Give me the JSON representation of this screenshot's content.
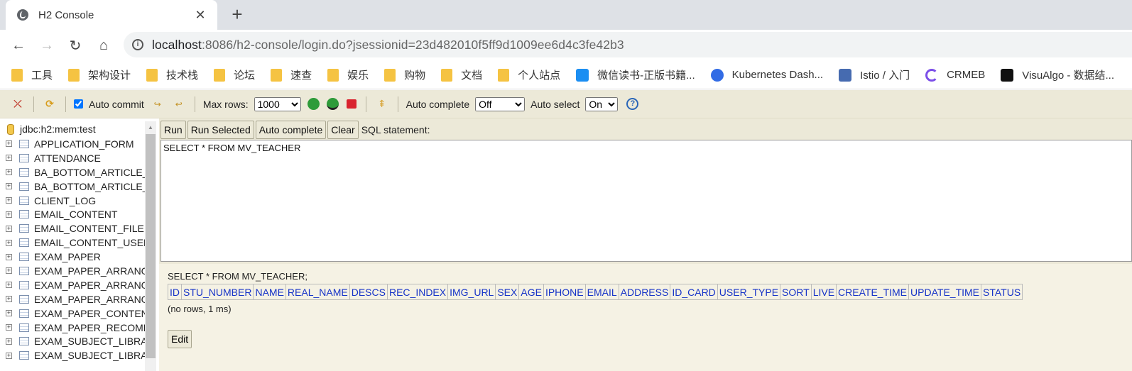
{
  "tab": {
    "title": "H2 Console",
    "close": "✕",
    "new_tab": "+"
  },
  "nav": {
    "back": "←",
    "forward": "→",
    "reload": "↻",
    "home": "⌂"
  },
  "url": {
    "host": "localhost",
    "rest": ":8086/h2-console/login.do?jsessionid=23d482010f5ff9d1009ee6d4c3fe42b3"
  },
  "bookmarks": [
    {
      "label": "工具",
      "icon": "folder-icon"
    },
    {
      "label": "架构设计",
      "icon": "folder-icon"
    },
    {
      "label": "技术栈",
      "icon": "folder-icon"
    },
    {
      "label": "论坛",
      "icon": "folder-icon"
    },
    {
      "label": "速查",
      "icon": "folder-icon"
    },
    {
      "label": "娱乐",
      "icon": "folder-icon"
    },
    {
      "label": "购物",
      "icon": "folder-icon"
    },
    {
      "label": "文档",
      "icon": "folder-icon"
    },
    {
      "label": "个人站点",
      "icon": "folder-icon"
    },
    {
      "label": "微信读书-正版书籍...",
      "icon": "weread-icon"
    },
    {
      "label": "Kubernetes Dash...",
      "icon": "kubernetes-icon"
    },
    {
      "label": "Istio / 入门",
      "icon": "istio-icon"
    },
    {
      "label": "CRMEB",
      "icon": "crmeb-icon"
    },
    {
      "label": "VisuAlgo - 数据结...",
      "icon": "visualgo-icon"
    }
  ],
  "toolbar": {
    "auto_commit": "Auto commit",
    "max_rows_label": "Max rows:",
    "max_rows_value": "1000",
    "auto_complete_label": "Auto complete",
    "auto_complete_value": "Off",
    "auto_select_label": "Auto select",
    "auto_select_value": "On",
    "help": "?"
  },
  "tree": {
    "root": "jdbc:h2:mem:test",
    "tables": [
      "APPLICATION_FORM",
      "ATTENDANCE",
      "BA_BOTTOM_ARTICLE_",
      "BA_BOTTOM_ARTICLE_",
      "CLIENT_LOG",
      "EMAIL_CONTENT",
      "EMAIL_CONTENT_FILE",
      "EMAIL_CONTENT_USER",
      "EXAM_PAPER",
      "EXAM_PAPER_ARRANG",
      "EXAM_PAPER_ARRANG",
      "EXAM_PAPER_ARRANG",
      "EXAM_PAPER_CONTEN",
      "EXAM_PAPER_RECOMM",
      "EXAM_SUBJECT_LIBRA",
      "EXAM_SUBJECT_LIBRA"
    ]
  },
  "query": {
    "run": "Run",
    "run_selected": "Run Selected",
    "auto_complete": "Auto complete",
    "clear": "Clear",
    "sql_label": "SQL statement:",
    "sql": "SELECT * FROM MV_TEACHER"
  },
  "result": {
    "statement": "SELECT * FROM MV_TEACHER;",
    "columns": [
      "ID",
      "STU_NUMBER",
      "NAME",
      "REAL_NAME",
      "DESCS",
      "REC_INDEX",
      "IMG_URL",
      "SEX",
      "AGE",
      "IPHONE",
      "EMAIL",
      "ADDRESS",
      "ID_CARD",
      "USER_TYPE",
      "SORT",
      "LIVE",
      "CREATE_TIME",
      "UPDATE_TIME",
      "STATUS"
    ],
    "summary": "(no rows, 1 ms)",
    "edit": "Edit"
  }
}
